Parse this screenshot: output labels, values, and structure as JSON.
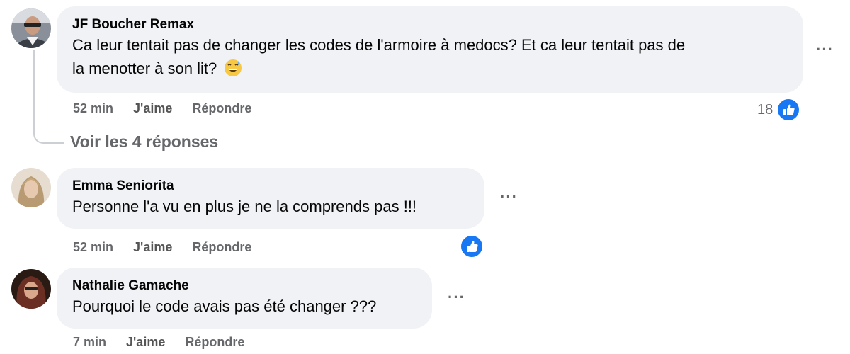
{
  "comments": [
    {
      "author": "JF Boucher Remax",
      "text_line1": "Ca leur tentait pas de changer les codes de l'armoire à medocs? Et ca leur tentait pas de",
      "text_line2": "la menotter à son lit?",
      "emoji": "grinning-sweat-emoji",
      "time": "52 min",
      "like_label": "J'aime",
      "reply_label": "Répondre",
      "reaction_count": "18",
      "more_label": "···"
    },
    {
      "author": "Emma Seniorita",
      "text": "Personne l'a vu en plus je ne la comprends pas !!!",
      "time": "52 min",
      "like_label": "J'aime",
      "reply_label": "Répondre",
      "more_label": "···"
    },
    {
      "author": "Nathalie Gamache",
      "text": "Pourquoi le code avais pas été changer ???",
      "time": "7 min",
      "like_label": "J'aime",
      "reply_label": "Répondre",
      "more_label": "···"
    }
  ],
  "see_replies_label": "Voir les 4 réponses",
  "colors": {
    "bubble": "#f0f2f5",
    "like_blue": "#1877f2",
    "secondary_text": "#65676b"
  }
}
